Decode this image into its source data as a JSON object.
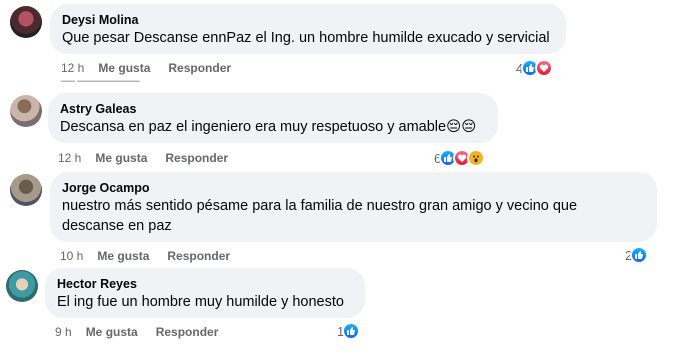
{
  "comments": [
    {
      "author": "Deysi Molina",
      "text": "Que pesar Descanse ennPaz el Ing. un hombre humilde exucado y servicial",
      "time": "12 h",
      "like_label": "Me gusta",
      "reply_label": "Responder",
      "reaction_count": "4",
      "reactions": [
        "like-icon",
        "heart-icon"
      ]
    },
    {
      "author": "Astry Galeas",
      "text": "Descansa en paz el ingeniero era muy respetuoso y amable😔😔",
      "time": "12 h",
      "like_label": "Me gusta",
      "reply_label": "Responder",
      "reaction_count": "6",
      "reactions": [
        "like-icon",
        "heart-icon",
        "wow-icon"
      ]
    },
    {
      "author": "Jorge Ocampo",
      "text_line1": "nuestro más sentido pésame para la familia de nuestro gran amigo y vecino que",
      "text_line2": "descanse en paz",
      "time": "10 h",
      "like_label": "Me gusta",
      "reply_label": "Responder",
      "reaction_count": "2",
      "reactions": [
        "like-icon"
      ]
    },
    {
      "author": "Hector Reyes",
      "text": "El ing fue un hombre muy humilde y honesto",
      "time": "9 h",
      "like_label": "Me gusta",
      "reply_label": "Responder",
      "reaction_count": "1",
      "reactions": [
        "like-icon"
      ]
    }
  ],
  "colors": {
    "bubble": "#f0f2f5",
    "meta_text": "#65676b",
    "like_blue": "#0866ff",
    "heart_red": "#e61739"
  }
}
